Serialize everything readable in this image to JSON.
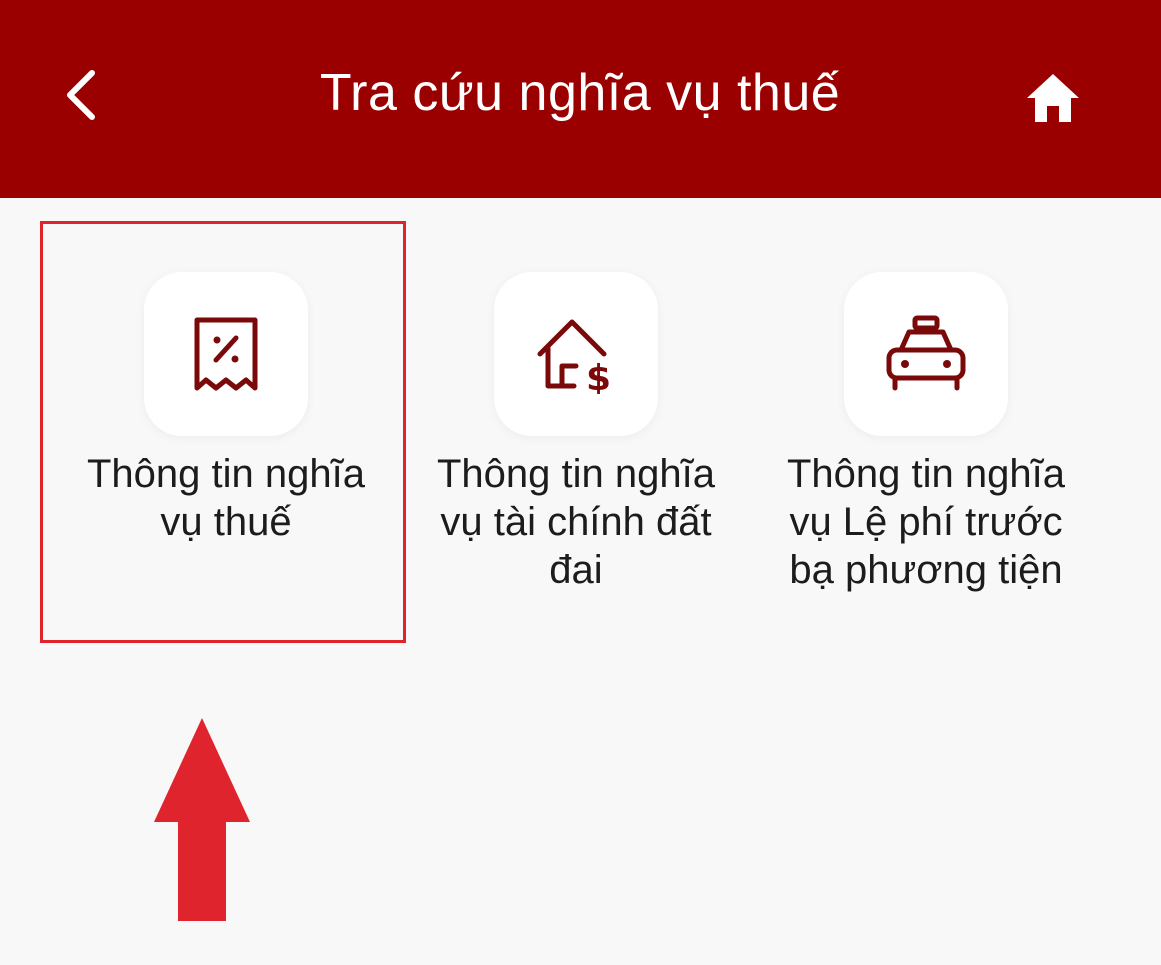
{
  "header": {
    "title": "Tra cứu nghĩa vụ thuế",
    "back_icon": "chevron-left-icon",
    "home_icon": "home-icon",
    "background_color": "#9a0000"
  },
  "menu": {
    "items": [
      {
        "label": "Thông tin nghĩa vụ thuế",
        "icon": "tax-receipt-icon"
      },
      {
        "label": "Thông tin nghĩa vụ tài chính đất đai",
        "icon": "house-dollar-icon"
      },
      {
        "label": "Thông tin nghĩa vụ Lệ phí trước bạ phương tiện",
        "icon": "taxi-icon"
      }
    ],
    "icon_color": "#7a0a0a"
  },
  "annotation": {
    "highlight_color": "#e0242e",
    "arrow_icon": "arrow-up-icon"
  }
}
